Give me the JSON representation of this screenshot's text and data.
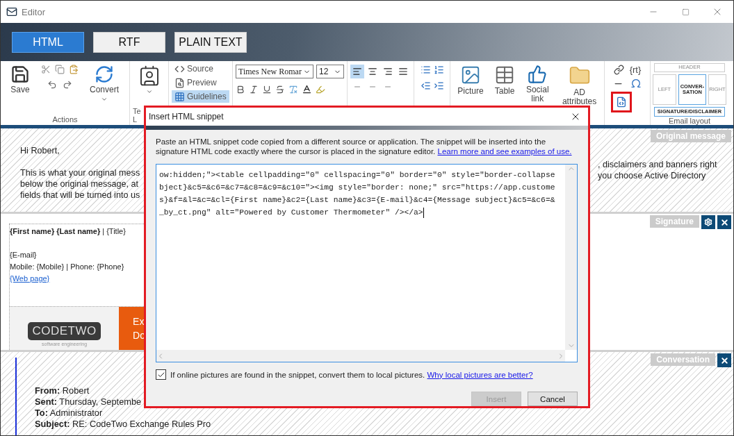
{
  "window": {
    "title": "Editor"
  },
  "format_tabs": [
    {
      "label": "HTML",
      "selected": true
    },
    {
      "label": "RTF",
      "selected": false
    },
    {
      "label": "PLAIN TEXT",
      "selected": false
    }
  ],
  "ribbon": {
    "actions": {
      "label": "Actions",
      "save": "Save",
      "convert": "Convert"
    },
    "template_group": {
      "label_lines": [
        "Te",
        "L"
      ]
    },
    "view_items": [
      {
        "label": "Source",
        "kind": "source",
        "selected": false
      },
      {
        "label": "Preview",
        "kind": "preview",
        "selected": false
      },
      {
        "label": "Guidelines",
        "kind": "guidelines",
        "selected": true
      }
    ],
    "font": {
      "family": "Times New Romar",
      "size": "12"
    },
    "alignments": [
      {
        "kind": "left",
        "selected": true
      },
      {
        "kind": "center",
        "selected": false
      },
      {
        "kind": "right",
        "selected": false
      },
      {
        "kind": "justify",
        "selected": false
      }
    ],
    "insert_items": [
      {
        "label": "Picture",
        "kind": "picture"
      },
      {
        "label": "Table",
        "kind": "table"
      },
      {
        "label": "Social link",
        "kind": "social"
      },
      {
        "label": "AD attributes",
        "kind": "folder"
      }
    ],
    "misc": {
      "rt": "{rt}",
      "snippet_highlighted": true
    },
    "email_layout": {
      "label": "Email layout",
      "options": [
        {
          "label": "HEADER",
          "kind": "header",
          "selected": false
        },
        {
          "label": "LEFT",
          "kind": "left",
          "selected": false
        },
        {
          "label": "CONVER-SATION",
          "kind": "conversation",
          "selected": true
        },
        {
          "label": "RIGHT",
          "kind": "right",
          "selected": false
        },
        {
          "label": "SIGNATURE/DISCLAIMER",
          "kind": "signature",
          "selected": true
        }
      ]
    }
  },
  "original_message": {
    "label": "Original message",
    "greeting": "Hi Robert,",
    "left_lines": [
      "This is what your original mess",
      "below the original message, at",
      "fields that will be turned into us"
    ],
    "right_lines": [
      ", disclaimers and banners right",
      "you choose Active Directory"
    ]
  },
  "signature": {
    "label": "Signature",
    "name_line": "**{First name} {Last name}** | {Title}",
    "email": "{E-mail}",
    "phones": "Mobile: {Mobile} | Phone: {Phone}",
    "web": "{Web page}",
    "logo": "CODETWO",
    "logo_tagline": "software engineering",
    "banner_lines": [
      "Ex",
      "Do"
    ]
  },
  "conversation": {
    "label": "Conversation",
    "fields": [
      {
        "name": "From:",
        "value": "Robert"
      },
      {
        "name": "Sent:",
        "value": "Thursday, Septembe"
      },
      {
        "name": "To:",
        "value": "Administrator"
      },
      {
        "name": "Subject:",
        "value": "RE: CodeTwo Exchange Rules Pro"
      }
    ]
  },
  "dialog": {
    "title": "Insert HTML snippet",
    "highlighted": true,
    "description": "Paste an HTML snippet code copied from a different source or application. The snippet will be inserted into the signature HTML code exactly where the cursor is placed in the signature editor.",
    "learn_link": "Learn more and see examples of use.",
    "code_lines": [
      "ow:hidden;\"><table cellpadding=\"0\" cellspacing=\"0\" border=\"0\" style=\"border-collapse",
      "bject}&c5=&c6=&c7=&c8=&c9=&c10=\"><img style=\"border: none;\" src=\"https://app.custome",
      "s}&f=&l=&c=&cl={First name}&c2={Last name}&c3={E-mail}&c4={Message subject}&c5=&c6=&",
      "_by_ct.png\" alt=\"Powered by Customer Thermometer\" /></a>"
    ],
    "checkbox": {
      "label": "If online pictures are found in the snippet, convert them to local pictures.",
      "checked": true,
      "link": "Why local pictures are better?"
    },
    "buttons": [
      {
        "label": "Insert",
        "disabled": true
      },
      {
        "label": "Cancel",
        "disabled": false
      }
    ]
  }
}
